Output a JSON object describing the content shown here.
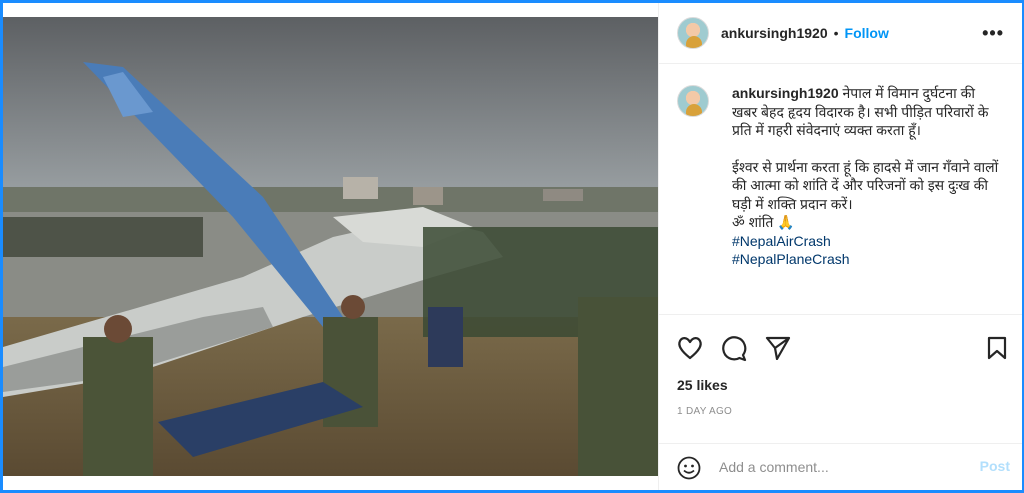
{
  "post": {
    "username": "ankursingh1920",
    "dot": "•",
    "follow_label": "Follow",
    "more_label": "•••",
    "caption": {
      "username": "ankursingh1920",
      "paragraph1": "नेपाल में विमान दुर्घटना की खबर बेहद हृदय विदारक है। सभी पीड़ित परिवारों के प्रति में गहरी संवेदनाएं व्यक्त करता हूँ।",
      "paragraph2": "ईश्वर से प्रार्थना करता हूं कि हादसे में जान गँवाने वालों की आत्मा को शांति दें और परिजनों को इस दुःख की घड़ी में शक्ति प्रदान करें।",
      "om_line": "ॐ शांति 🙏",
      "hashtags": [
        "#NepalAirCrash",
        "#NepalPlaneCrash"
      ]
    },
    "likes": "25 likes",
    "time": "1 DAY AGO",
    "comment_placeholder": "Add a comment...",
    "post_label": "Post"
  },
  "icons": {
    "like": "heart-icon",
    "comment": "comment-icon",
    "share": "share-icon",
    "save": "bookmark-icon",
    "emoji": "emoji-icon"
  },
  "colors": {
    "accent": "#0095f6",
    "frame": "#1a8cff",
    "text": "#262626",
    "muted": "#8e8e8e"
  }
}
